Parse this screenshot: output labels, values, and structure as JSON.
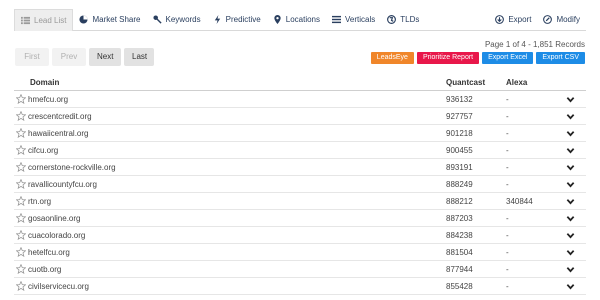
{
  "tabs": [
    {
      "label": "Lead List",
      "icon": "list-icon",
      "active": true
    },
    {
      "label": "Market Share",
      "icon": "pie-chart-icon"
    },
    {
      "label": "Keywords",
      "icon": "key-icon"
    },
    {
      "label": "Predictive",
      "icon": "bolt-icon"
    },
    {
      "label": "Locations",
      "icon": "map-marker-icon"
    },
    {
      "label": "Verticals",
      "icon": "list-lines-icon"
    },
    {
      "label": "TLDs",
      "icon": "globe-icon"
    }
  ],
  "tab_actions": [
    {
      "label": "Export",
      "icon": "export-icon"
    },
    {
      "label": "Modify",
      "icon": "modify-icon"
    }
  ],
  "pager": {
    "first": "First",
    "prev": "Prev",
    "next": "Next",
    "last": "Last"
  },
  "page_info": "Page 1 of 4 - 1,851 Records",
  "actions": [
    {
      "label": "LeadsEye",
      "color": "#f0862a"
    },
    {
      "label": "Prioritize Report",
      "color": "#e8174a"
    },
    {
      "label": "Export Excel",
      "color": "#1d8ce6"
    },
    {
      "label": "Export CSV",
      "color": "#1d8ce6"
    }
  ],
  "columns": {
    "domain": "Domain",
    "quantcast": "Quantcast",
    "alexa": "Alexa"
  },
  "rows": [
    {
      "domain": "hmefcu.org",
      "quantcast": "936132",
      "alexa": "-"
    },
    {
      "domain": "crescentcredit.org",
      "quantcast": "927757",
      "alexa": "-"
    },
    {
      "domain": "hawaiicentral.org",
      "quantcast": "901218",
      "alexa": "-"
    },
    {
      "domain": "cifcu.org",
      "quantcast": "900455",
      "alexa": "-"
    },
    {
      "domain": "cornerstone-rockville.org",
      "quantcast": "893191",
      "alexa": "-"
    },
    {
      "domain": "ravallicountyfcu.org",
      "quantcast": "888249",
      "alexa": "-"
    },
    {
      "domain": "rtn.org",
      "quantcast": "888212",
      "alexa": "340844"
    },
    {
      "domain": "gosaonline.org",
      "quantcast": "887203",
      "alexa": "-"
    },
    {
      "domain": "cuacolorado.org",
      "quantcast": "884238",
      "alexa": "-"
    },
    {
      "domain": "hetelfcu.org",
      "quantcast": "881504",
      "alexa": "-"
    },
    {
      "domain": "cuotb.org",
      "quantcast": "877944",
      "alexa": "-"
    },
    {
      "domain": "civilservicecu.org",
      "quantcast": "855428",
      "alexa": "-"
    }
  ]
}
